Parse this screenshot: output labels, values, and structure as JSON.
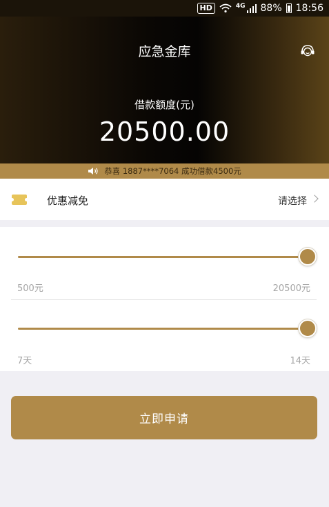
{
  "status_bar": {
    "hd": "HD",
    "network": "4G",
    "battery": "88%",
    "time": "18:56"
  },
  "header": {
    "title": "应急金库",
    "amount_label": "借款额度(元)",
    "amount": "20500.00"
  },
  "notice": {
    "text": "恭喜 1887****7064 成功借款4500元"
  },
  "coupon": {
    "label": "优惠减免",
    "select_text": "请选择"
  },
  "amount_slider": {
    "min_label": "500元",
    "max_label": "20500元",
    "value_fraction": 1.0
  },
  "term_slider": {
    "min_label": "7天",
    "max_label": "14天",
    "value_fraction": 1.0
  },
  "apply_button": {
    "label": "立即申请"
  },
  "colors": {
    "accent": "#b08a49",
    "header_dark": "#0a0704",
    "coupon_icon": "#e7c45a"
  },
  "icons": {
    "customer_service": "customer-service-icon",
    "speaker": "speaker-icon",
    "coupon": "ticket-icon",
    "chevron": "chevron-right-icon"
  }
}
